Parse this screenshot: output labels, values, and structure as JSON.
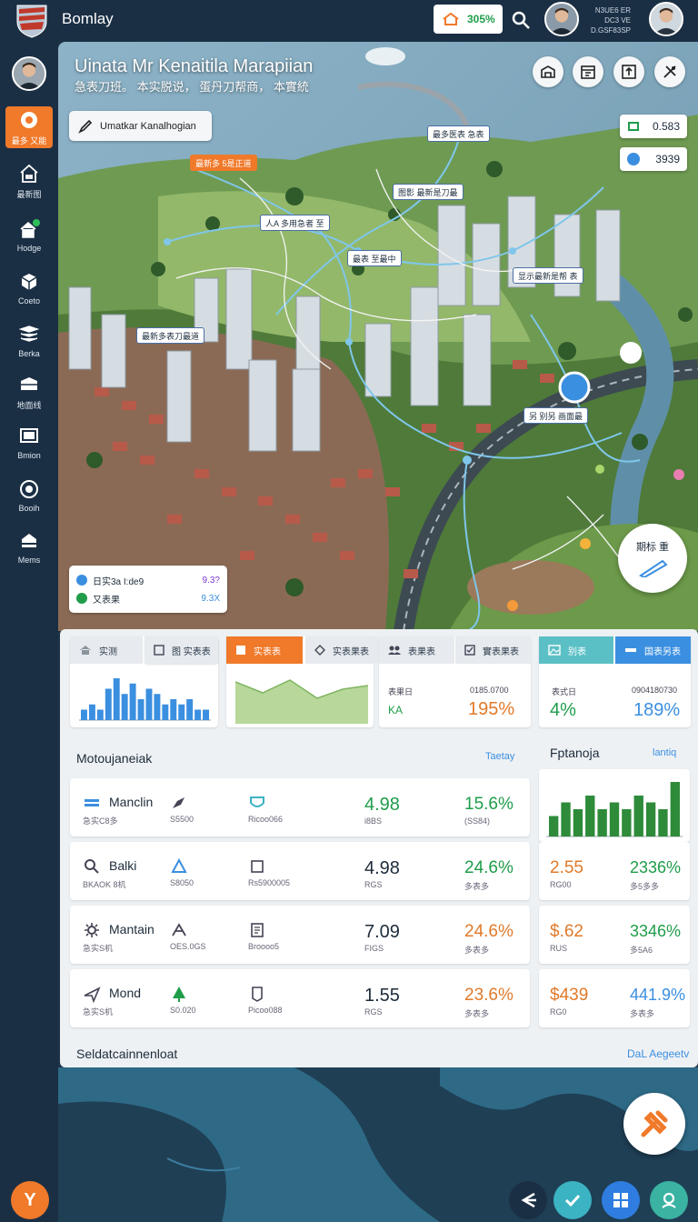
{
  "app": {
    "title": "Bomlay",
    "logo": "flag-shield-logo"
  },
  "topbar": {
    "pill_value": "305%",
    "pill_icon": "home-icon",
    "meta_lines": [
      "N3UE6 ER",
      "DC3 VE",
      "D.GSF83SP"
    ]
  },
  "sidebar": {
    "items": [
      {
        "label": "最多 又能",
        "icon": "record-icon",
        "active": true
      },
      {
        "label": "最新图",
        "icon": "building-icon"
      },
      {
        "label": "Hodge",
        "icon": "house-plus-icon"
      },
      {
        "label": "Coeto",
        "icon": "cube-icon"
      },
      {
        "label": "Berka",
        "icon": "layers-icon"
      },
      {
        "label": "地面线",
        "icon": "box-icon"
      },
      {
        "label": "Bmion",
        "icon": "monitor-icon"
      },
      {
        "label": "Booih",
        "icon": "target-icon"
      },
      {
        "label": "Mems",
        "icon": "flag-icon"
      }
    ],
    "bottom_label": "Y"
  },
  "map": {
    "title": "Uinata Mr Kenaitila Marapiian",
    "subtitle": "急表刀班。 本实脱说， 蛋丹刀帮商， 本實統",
    "search_label": "Umatkar Kanalhogian",
    "stats": [
      {
        "icon": "grid-icon",
        "value": "0.583",
        "color": "#1f9d4a"
      },
      {
        "icon": "dot-icon",
        "value": "3939",
        "color": "#3b8fe0"
      }
    ],
    "labels": [
      {
        "text": "最新多 5是正道",
        "style": "orange"
      },
      {
        "text": "最多医表 急表",
        "style": "normal"
      },
      {
        "text": "图影 最新是刀最",
        "style": "normal"
      },
      {
        "text": "人A 多用急者 至",
        "style": "normal"
      },
      {
        "text": "最表 至最中",
        "style": "normal"
      },
      {
        "text": "显示最新是帮 表",
        "style": "normal"
      },
      {
        "text": "最新多表刀最道",
        "style": "normal"
      },
      {
        "text": "另 别另 画面最",
        "style": "normal"
      }
    ],
    "legend": [
      {
        "label": "日实3a I:de9",
        "value": "9.3?",
        "color": "#3b8fe0",
        "value_color": "#7a3bd0"
      },
      {
        "label": "又表果",
        "value": "9.3X",
        "color": "#1f9d4a",
        "value_color": "#3b8fe0"
      }
    ],
    "fab_label": "期标 重"
  },
  "dashboard": {
    "tabs": [
      {
        "label": "实测",
        "icon": "home-icon",
        "style": "normal"
      },
      {
        "label": "图 实表表",
        "icon": "square-icon",
        "style": "normal"
      },
      {
        "label": "实表表",
        "icon": "square-icon",
        "style": "active"
      },
      {
        "label": "实表果表",
        "icon": "diamond-icon",
        "style": "normal"
      },
      {
        "label": "表果表",
        "icon": "people-icon",
        "style": "normal"
      },
      {
        "label": "實表果表",
        "icon": "check-icon",
        "style": "normal"
      },
      {
        "label": "别表",
        "icon": "image-icon",
        "style": "teal"
      },
      {
        "label": "国表另表",
        "icon": "bar-icon",
        "style": "blue"
      }
    ],
    "kpi_a": {
      "label": "表果日",
      "sub": "KA",
      "value": "0185.0700",
      "pct": "195%"
    },
    "kpi_b": {
      "label": "表式日",
      "value": "0904180730",
      "left": "4%",
      "right": "189%"
    },
    "mini_bars": [
      2,
      3,
      2,
      6,
      8,
      5,
      7,
      4,
      6,
      5,
      3,
      4,
      3,
      4,
      2,
      2
    ],
    "section_left": {
      "title": "Motoujaneiak",
      "link": "Taetay"
    },
    "section_right": {
      "title": "Fptanoja",
      "link": "lantiq"
    },
    "right_bars": [
      3,
      5,
      4,
      6,
      4,
      5,
      4,
      6,
      5,
      4,
      8
    ],
    "rows": [
      {
        "name": "Manclin",
        "sub": "急实C8多",
        "icon": "ruler-icon",
        "icon2": "pen-icon",
        "mid": "S5500",
        "icon3": "shield-icon",
        "mid2": "Ricoo066",
        "value": "4.98",
        "value_sub": "i8BS",
        "pct": "15.6%",
        "pct_sub": "(SS84)",
        "value_color": "#1f9d4a",
        "pct_color": "#1f9d4a"
      },
      {
        "name": "Balki",
        "sub": "BKAOK 8机",
        "icon": "search-icon",
        "icon2": "triangle-icon",
        "mid": "S8050",
        "icon3": "cup-icon",
        "mid2": "Rs5900005",
        "value": "4.98",
        "value_sub": "RGS",
        "pct": "24.6%",
        "pct_sub": "多表多",
        "value_color": "#1d2b3a",
        "pct_color": "#1f9d4a"
      },
      {
        "name": "Mantain",
        "sub": "急实S机",
        "icon": "gear-icon",
        "icon2": "crane-icon",
        "mid": "OES.0GS",
        "icon3": "document-icon",
        "mid2": "Broooo5",
        "value": "7.09",
        "value_sub": "FIGS",
        "pct": "24.6%",
        "pct_sub": "多表多",
        "value_color": "#1d2b3a",
        "pct_color": "#e07a2a"
      },
      {
        "name": "Mond",
        "sub": "急实S机",
        "icon": "plane-icon",
        "icon2": "tree-icon",
        "mid": "S0.020",
        "icon3": "tag-icon",
        "mid2": "Picoo088",
        "value": "1.55",
        "value_sub": "RGS",
        "pct": "23.6%",
        "pct_sub": "多表多",
        "value_color": "#1d2b3a",
        "pct_color": "#e07a2a"
      }
    ],
    "side_rows": [
      {
        "a": "2.55",
        "as": "RG00",
        "b": "2336%",
        "bs": "多5多多",
        "b_color": "#1f9d4a"
      },
      {
        "a": "$.62",
        "as": "RUS",
        "b": "3346%",
        "bs": "多5A6",
        "b_color": "#1f9d4a"
      },
      {
        "a": "$439",
        "as": "RG0",
        "b": "441.9%",
        "bs": "多表多",
        "b_color": "#3b8fe0"
      }
    ],
    "footer": {
      "text": "Seldatcainnenloat",
      "link": "DaL Aegeetv"
    }
  },
  "bottom": {
    "fab_icon": "wrench-icon",
    "buttons": [
      {
        "icon": "arrow-left-icon",
        "color": "#1b2f44"
      },
      {
        "icon": "check-icon",
        "color": "#3bb3c2"
      },
      {
        "icon": "grid-icon",
        "color": "#2f7de0"
      },
      {
        "icon": "user-icon",
        "color": "#3bb3a2"
      }
    ]
  },
  "colors": {
    "accent": "#f0792a",
    "sidebar": "#1b2f44",
    "green": "#1f9d4a",
    "blue": "#3b8fe0"
  }
}
